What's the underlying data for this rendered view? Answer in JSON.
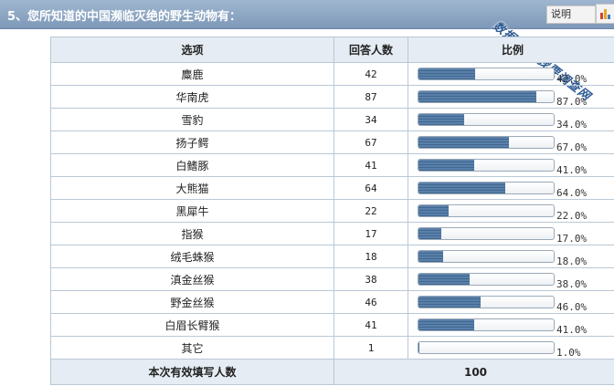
{
  "header": {
    "title": "5、您所知道的中国濒临灭绝的野生动物有：",
    "explain_label": "说明",
    "watermark": "数据来源 我要调查网",
    "colors": {
      "header_bg": "#8aa5c4",
      "bar_fill": "#4a72a0",
      "table_header_bg": "#e5ecf3"
    }
  },
  "table": {
    "columns": [
      "选项",
      "回答人数",
      "比例"
    ],
    "rows": [
      {
        "option": "麋鹿",
        "count": "42",
        "percent": "42.0%",
        "ratio": 0.42
      },
      {
        "option": "华南虎",
        "count": "87",
        "percent": "87.0%",
        "ratio": 0.87
      },
      {
        "option": "雪豹",
        "count": "34",
        "percent": "34.0%",
        "ratio": 0.34
      },
      {
        "option": "扬子鳄",
        "count": "67",
        "percent": "67.0%",
        "ratio": 0.67
      },
      {
        "option": "白鳍豚",
        "count": "41",
        "percent": "41.0%",
        "ratio": 0.41
      },
      {
        "option": "大熊猫",
        "count": "64",
        "percent": "64.0%",
        "ratio": 0.64
      },
      {
        "option": "黑犀牛",
        "count": "22",
        "percent": "22.0%",
        "ratio": 0.22
      },
      {
        "option": "指猴",
        "count": "17",
        "percent": "17.0%",
        "ratio": 0.17
      },
      {
        "option": "绒毛蛛猴",
        "count": "18",
        "percent": "18.0%",
        "ratio": 0.18
      },
      {
        "option": "滇金丝猴",
        "count": "38",
        "percent": "38.0%",
        "ratio": 0.38
      },
      {
        "option": "野金丝猴",
        "count": "46",
        "percent": "46.0%",
        "ratio": 0.46
      },
      {
        "option": "白眉长臂猴",
        "count": "41",
        "percent": "41.0%",
        "ratio": 0.41
      },
      {
        "option": "其它",
        "count": "1",
        "percent": "1.0%",
        "ratio": 0.01
      }
    ],
    "footer": {
      "label": "本次有效填写人数",
      "value": "100"
    }
  }
}
